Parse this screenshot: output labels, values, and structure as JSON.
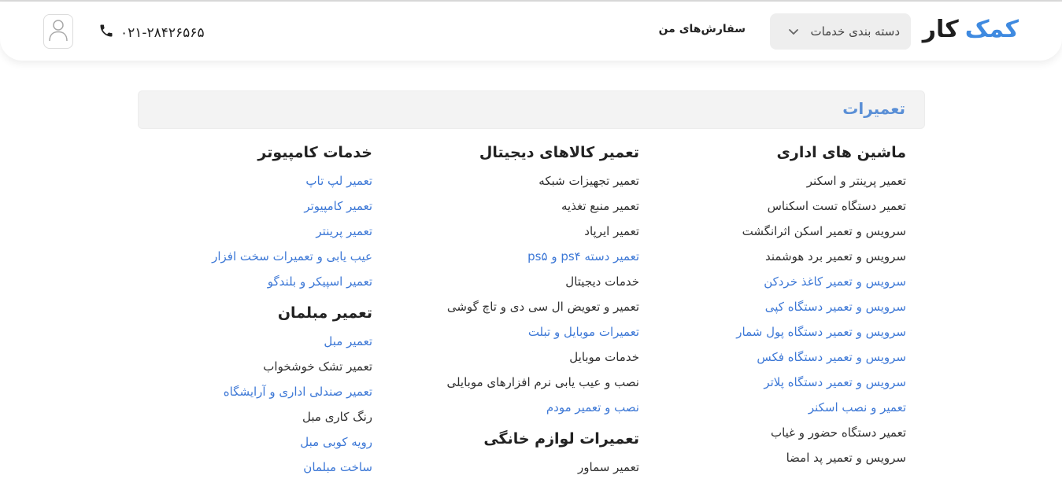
{
  "brand": {
    "word1": "کمک",
    "word2": "کار"
  },
  "header": {
    "category_label": "دسته بندی  خدمات",
    "orders_label": "سفارش‌های من",
    "phone": "۰۲۱-۲۸۴۲۶۵۶۵"
  },
  "colors": {
    "accent": "#3f8ae0",
    "link": "#3d78d6",
    "section_title": "#5a8fd6"
  },
  "section": {
    "title": "تعمیرات"
  },
  "columns": [
    {
      "groups": [
        {
          "title": "ماشین های اداری",
          "items": [
            {
              "label": "تعمیر پرینتر و اسکنر",
              "link": false
            },
            {
              "label": "تعمیر دستگاه تست اسکناس",
              "link": false
            },
            {
              "label": "سرویس و تعمیر اسکن اثرانگشت",
              "link": false
            },
            {
              "label": "سرویس و تعمیر برد هوشمند",
              "link": false
            },
            {
              "label": "سرویس و تعمیر کاغذ خردکن",
              "link": true
            },
            {
              "label": "سرویس و تعمیر دستگاه کپی",
              "link": true
            },
            {
              "label": "سرویس و تعمیر دستگاه پول شمار",
              "link": true
            },
            {
              "label": "سرویس و تعمیر دستگاه فکس",
              "link": true
            },
            {
              "label": "سرویس و تعمیر دستگاه پلاتر",
              "link": true
            },
            {
              "label": "تعمیر و نصب اسکنر",
              "link": true
            },
            {
              "label": "تعمیر دستگاه حضور و غیاب",
              "link": false
            },
            {
              "label": "سرویس و تعمیر پد امضا",
              "link": false
            }
          ]
        }
      ]
    },
    {
      "groups": [
        {
          "title": "تعمیر کالاهای دیجیتال",
          "items": [
            {
              "label": "تعمیر تجهیزات شبکه",
              "link": false
            },
            {
              "label": "تعمیر منبع تغذیه",
              "link": false
            },
            {
              "label": "تعمیر ایرپاد",
              "link": false
            },
            {
              "label": "تعمیر دسته ps۴ و ps۵",
              "link": true
            },
            {
              "label": "خدمات دیجیتال",
              "link": false
            },
            {
              "label": "تعمیر و تعویض ال سی دی و تاچ گوشی",
              "link": false
            },
            {
              "label": "تعمیرات موبایل و تبلت",
              "link": true
            },
            {
              "label": "خدمات موبایل",
              "link": false
            },
            {
              "label": "نصب و عیب یابی نرم افزارهای موبایلی",
              "link": false
            },
            {
              "label": "نصب و تعمیر مودم",
              "link": true
            }
          ]
        },
        {
          "title": "تعمیرات لوازم خانگی",
          "items": [
            {
              "label": "تعمیر سماور",
              "link": false
            }
          ]
        }
      ]
    },
    {
      "groups": [
        {
          "title": "خدمات کامپیوتر",
          "items": [
            {
              "label": "تعمیر لپ تاپ",
              "link": true
            },
            {
              "label": "تعمیر کامپیوتر",
              "link": true
            },
            {
              "label": "تعمیر پرینتر",
              "link": true
            },
            {
              "label": "عیب یابی و تعمیرات سخت افزار",
              "link": true
            },
            {
              "label": "تعمیر اسپیکر و بلندگو",
              "link": true
            }
          ]
        },
        {
          "title": "تعمیر مبلمان",
          "items": [
            {
              "label": "تعمیر مبل",
              "link": true
            },
            {
              "label": "تعمیر تشک خوشخواب",
              "link": false
            },
            {
              "label": "تعمیر صندلی اداری و آرایشگاه",
              "link": true
            },
            {
              "label": "رنگ کاری مبل",
              "link": false
            },
            {
              "label": "رویه کوبی مبل",
              "link": true
            },
            {
              "label": "ساخت مبلمان",
              "link": true
            }
          ]
        }
      ]
    }
  ]
}
